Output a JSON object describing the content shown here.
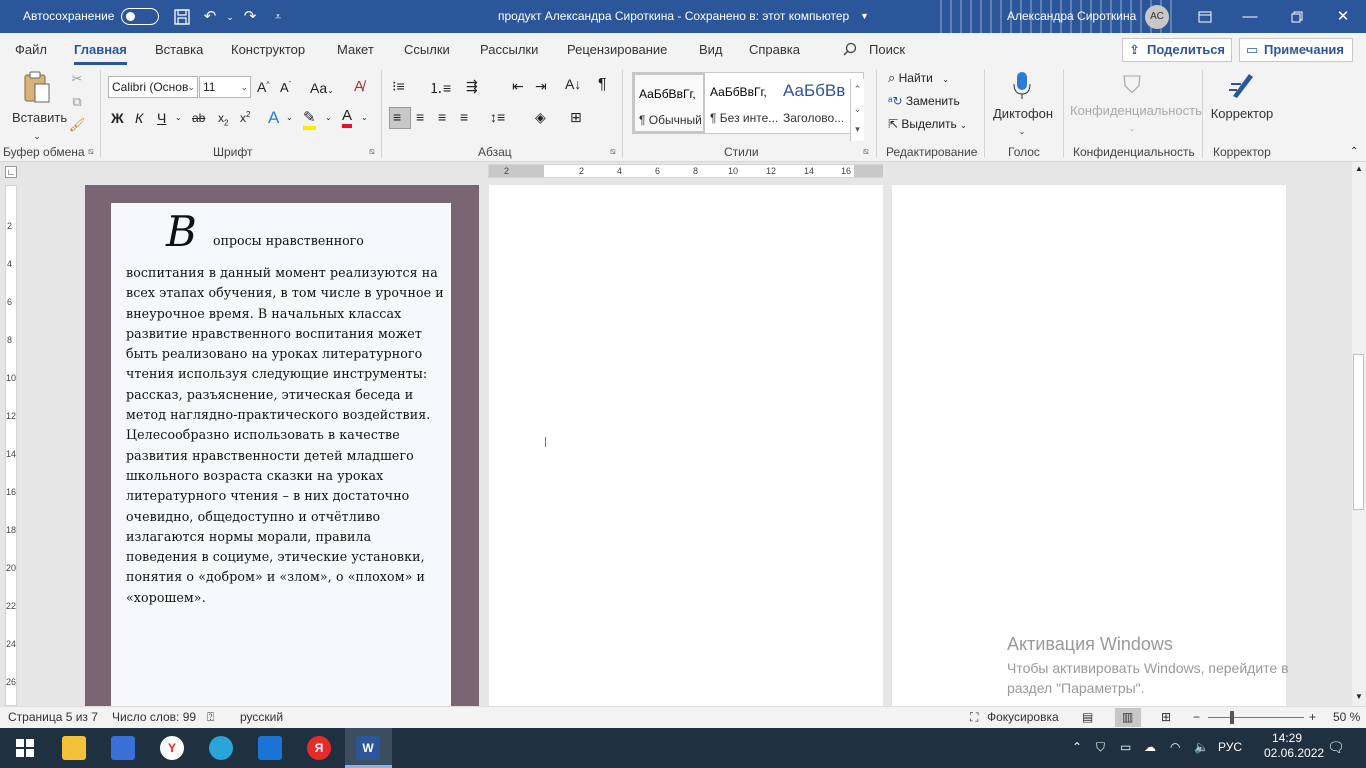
{
  "titlebar": {
    "autosave_label": "Автосохранение",
    "doc_title": "продукт Александра Сироткина  -  Сохранено в: этот компьютер",
    "user_name": "Александра Сироткина",
    "user_initials": "АС"
  },
  "tabs": [
    "Файл",
    "Главная",
    "Вставка",
    "Конструктор",
    "Макет",
    "Ссылки",
    "Рассылки",
    "Рецензирование",
    "Вид",
    "Справка"
  ],
  "active_tab": "Главная",
  "search_label": "Поиск",
  "share_label": "Поделиться",
  "comments_label": "Примечания",
  "ribbon": {
    "paste_label": "Вставить",
    "font_name": "Calibri (Основ",
    "font_size": "11",
    "styles": [
      {
        "preview": "АаБбВвГг,",
        "name": "¶ Обычный"
      },
      {
        "preview": "АаБбВвГг,",
        "name": "¶ Без инте..."
      },
      {
        "preview": "АаБбВв",
        "name": "Заголово..."
      }
    ],
    "find_label": "Найти",
    "replace_label": "Заменить",
    "select_label": "Выделить",
    "dictate_label": "Диктофон",
    "sensitivity_label": "Конфиденциальность",
    "editor_label": "Корректор",
    "groups": {
      "clipboard": "Буфер обмена",
      "font": "Шрифт",
      "paragraph": "Абзац",
      "styles": "Стили",
      "editing": "Редактирование",
      "voice": "Голос",
      "sensitivity": "Конфиденциальность",
      "editor": "Корректор"
    }
  },
  "document": {
    "drop_cap": "В",
    "first_line": "опросы нравственного",
    "body": "воспитания в данный момент реализуются на всех этапах обучения, в том числе в урочное и внеурочное время. В начальных классах развитие нравственного воспитания может быть реализовано на уроках литературного чтения используя следующие инструменты: рассказ, разъяснение, этическая беседа и метод наглядно-практического воздействия. Целесообразно использовать в качестве развития нравственности детей младшего школьного возраста сказки на уроках литературного чтения – в них достаточно очевидно, общедоступно и отчётливо излагаются нормы морали, правила поведения в социуме, этические установки, понятия о «добром» и «злом», о «плохом» и «хорошем»."
  },
  "ruler": {
    "h_ticks": [
      "2",
      "2",
      "4",
      "6",
      "8",
      "10",
      "12",
      "14",
      "16"
    ],
    "v_ticks": [
      "2",
      "4",
      "6",
      "8",
      "10",
      "12",
      "14",
      "16",
      "18",
      "20",
      "22",
      "24",
      "26"
    ]
  },
  "watermark": {
    "title": "Активация Windows",
    "line1": "Чтобы активировать Windows, перейдите в",
    "line2": "раздел \"Параметры\"."
  },
  "status": {
    "page": "Страница 5 из 7",
    "words": "Число слов: 99",
    "language": "русский",
    "focus": "Фокусировка",
    "zoom": "50 %"
  },
  "taskbar": {
    "lang": "РУС",
    "time": "14:29",
    "date": "02.06.2022"
  },
  "colors": {
    "word_blue": "#2b579a",
    "page_border": "#7a6574"
  }
}
